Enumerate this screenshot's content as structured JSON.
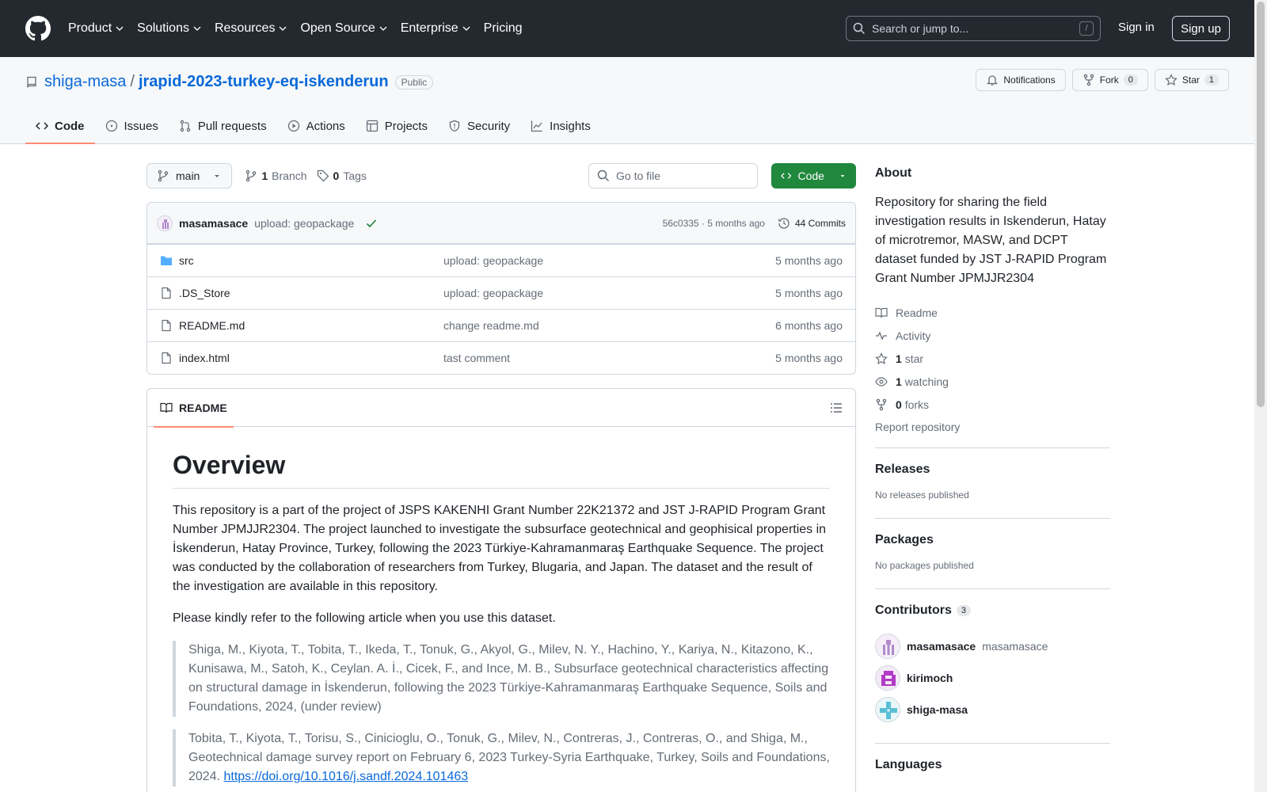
{
  "header": {
    "nav": [
      "Product",
      "Solutions",
      "Resources",
      "Open Source",
      "Enterprise",
      "Pricing"
    ],
    "search_placeholder": "Search or jump to...",
    "search_shortcut": "/",
    "signin": "Sign in",
    "signup": "Sign up"
  },
  "repo": {
    "owner": "shiga-masa",
    "separator": "/",
    "name": "jrapid-2023-turkey-eq-iskenderun",
    "visibility": "Public",
    "notifications": "Notifications",
    "fork_label": "Fork",
    "fork_count": "0",
    "star_label": "Star",
    "star_count": "1",
    "tabs": [
      "Code",
      "Issues",
      "Pull requests",
      "Actions",
      "Projects",
      "Security",
      "Insights"
    ]
  },
  "files": {
    "branch": "main",
    "branch_count": "1",
    "branch_label": "Branch",
    "tag_count": "0",
    "tag_label": "Tags",
    "goto_placeholder": "Go to file",
    "code_button": "Code",
    "commit": {
      "author": "masamasace",
      "message": "upload: geopackage",
      "hash_time": "56c0335 · 5 months ago",
      "commits": "44 Commits"
    },
    "rows": [
      {
        "name": "src",
        "type": "folder",
        "message": "upload: geopackage",
        "age": "5 months ago"
      },
      {
        "name": ".DS_Store",
        "type": "file",
        "message": "upload: geopackage",
        "age": "5 months ago"
      },
      {
        "name": "README.md",
        "type": "file",
        "message": "change readme.md",
        "age": "6 months ago"
      },
      {
        "name": "index.html",
        "type": "file",
        "message": "tast comment",
        "age": "5 months ago"
      }
    ]
  },
  "readme": {
    "tab": "README",
    "heading": "Overview",
    "para1": "This repository is a part of the project of JSPS KAKENHI Grant Number 22K21372 and JST J-RAPID Program Grant Number JPMJJR2304. The project launched to investigate the subsurface geotechnical and geophisical properties in İskenderun, Hatay Province, Turkey, following the 2023 Türkiye-Kahramanmaraş Earthquake Sequence. The project was conducted by the collaboration of researchers from Turkey, Blugaria, and Japan. The dataset and the result of the investigation are available in this repository.",
    "para2": "Please kindly refer to the following article when you use this dataset.",
    "quote1": "Shiga, M., Kiyota, T., Tobita, T., Ikeda, T., Tonuk, G., Akyol, G., Milev, N. Y., Hachino, Y., Kariya, N., Kitazono, K., Kunisawa, M., Satoh, K., Ceylan. A. İ., Cicek, F., and Ince, M. B., Subsurface geotechnical characteristics affecting on structural damage in İskenderun, following the 2023 Türkiye-Kahramanmaraş Earthquake Sequence, Soils and Foundations, 2024, (under review)",
    "quote2": "Tobita, T., Kiyota, T., Torisu, S., Cinicioglu, O., Tonuk, G., Milev, N., Contreras, J., Contreras, O., and Shiga, M., Geotechnical damage survey report on February 6, 2023 Turkey-Syria Earthquake, Turkey, Soils and Foundations, 2024. ",
    "quote2_link": "https://doi.org/10.1016/j.sandf.2024.101463"
  },
  "sidebar": {
    "about_title": "About",
    "about_text": "Repository for sharing the field investigation results in Iskenderun, Hatay of microtremor, MASW, and DCPT dataset funded by JST J-RAPID Program Grant Number JPMJJR2304",
    "readme": "Readme",
    "activity": "Activity",
    "stars_count": "1",
    "stars_label": "star",
    "watching_count": "1",
    "watching_label": "watching",
    "forks_count": "0",
    "forks_label": "forks",
    "report": "Report repository",
    "releases_title": "Releases",
    "releases_text": "No releases published",
    "packages_title": "Packages",
    "packages_text": "No packages published",
    "contributors_title": "Contributors",
    "contributors_count": "3",
    "contributors": [
      {
        "login": "masamasace",
        "name": "masamasace"
      },
      {
        "login": "kirimoch",
        "name": ""
      },
      {
        "login": "shiga-masa",
        "name": ""
      }
    ],
    "languages_title": "Languages"
  }
}
